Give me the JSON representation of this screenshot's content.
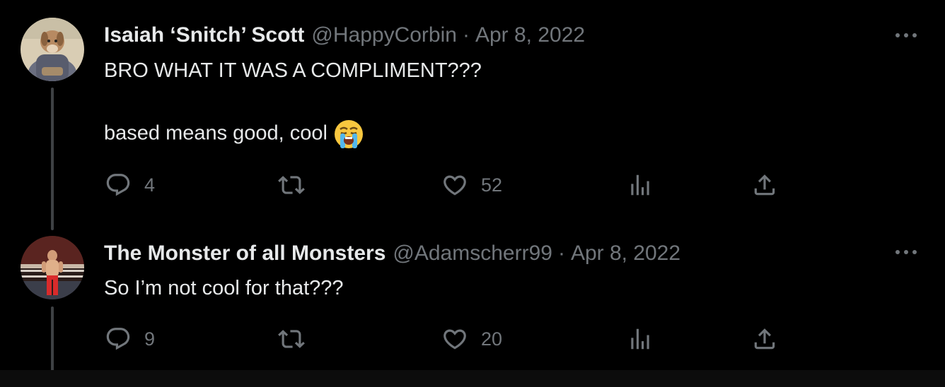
{
  "tweets": [
    {
      "display_name": "Isaiah ‘Snitch’ Scott",
      "handle": "@HappyCorbin",
      "separator": "·",
      "date": "Apr 8, 2022",
      "text_line1": "BRO WHAT IT WAS A COMPLIMENT???",
      "text_line2": "based means good, cool",
      "emoji": "loudly-crying-face",
      "reply_count": "4",
      "like_count": "52"
    },
    {
      "display_name": "The Monster of all Monsters",
      "handle": "@Adamscherr99",
      "separator": "·",
      "date": "Apr 8, 2022",
      "text_line1": "So I’m not cool for that???",
      "reply_count": "9",
      "like_count": "20"
    }
  ],
  "icons": {
    "reply": "reply-icon",
    "retweet": "retweet-icon",
    "like": "heart-icon",
    "views": "analytics-icon",
    "share": "share-icon",
    "more": "more-icon"
  },
  "colors": {
    "background": "#000000",
    "text_primary": "#e7e9ea",
    "text_secondary": "#71767b",
    "thread_line": "#3e4144"
  }
}
